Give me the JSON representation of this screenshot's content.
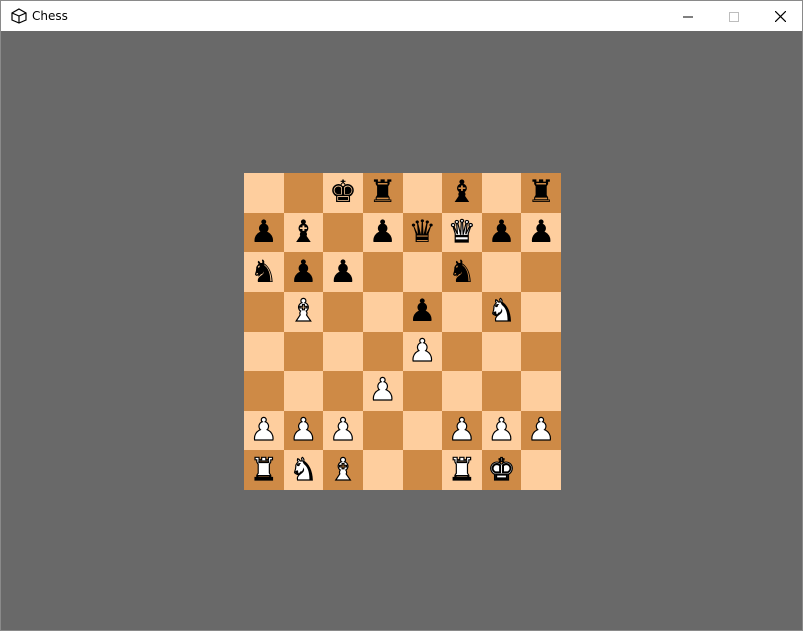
{
  "window": {
    "title": "Chess",
    "controls": [
      "minimize-icon",
      "maximize-icon",
      "close-icon"
    ]
  },
  "colors": {
    "background": "#696969",
    "light_square": "#FECE9E",
    "dark_square": "#CE8A46"
  },
  "board": {
    "ranks": [
      [
        "",
        "",
        "bk",
        "br",
        "",
        "bb",
        "",
        "br"
      ],
      [
        "bp",
        "bb",
        "",
        "bp",
        "bq",
        "wq",
        "bp",
        "bp"
      ],
      [
        "bn",
        "bp",
        "bp",
        "",
        "",
        "bn",
        "",
        ""
      ],
      [
        "",
        "wb",
        "",
        "",
        "bp",
        "",
        "wn",
        ""
      ],
      [
        "",
        "",
        "",
        "",
        "wp",
        "",
        "",
        ""
      ],
      [
        "",
        "",
        "",
        "wp",
        "",
        "",
        "",
        ""
      ],
      [
        "wp",
        "wp",
        "wp",
        "",
        "",
        "wp",
        "wp",
        "wp"
      ],
      [
        "wr",
        "wn",
        "wb",
        "",
        "",
        "wr",
        "wk",
        ""
      ]
    ]
  }
}
